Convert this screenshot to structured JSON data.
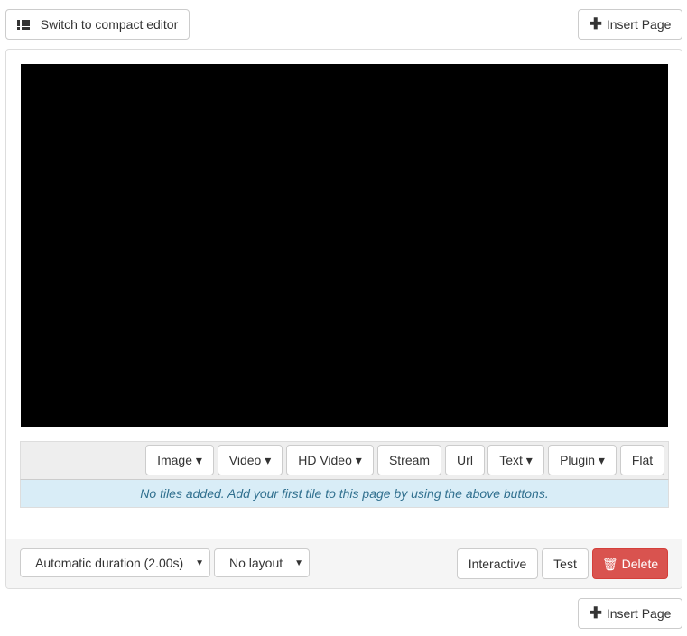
{
  "top": {
    "compact_label": "Switch to compact editor",
    "insert_label": "Insert Page"
  },
  "toolbar": {
    "buttons": [
      "Image ▾",
      "Video ▾",
      "HD Video ▾",
      "Stream",
      "Url",
      "Text ▾",
      "Plugin ▾",
      "Flat"
    ]
  },
  "info": "No tiles added. Add your first tile to this page by using the above buttons.",
  "footer": {
    "duration": "Automatic duration (2.00s)",
    "layout": "No layout",
    "interactive": "Interactive",
    "test": "Test",
    "delete": "Delete"
  },
  "bottom": {
    "insert_label": "Insert Page"
  },
  "colors": {
    "delete": "#d9534f",
    "info_bg": "#d9edf7",
    "info_text": "#31708f"
  }
}
